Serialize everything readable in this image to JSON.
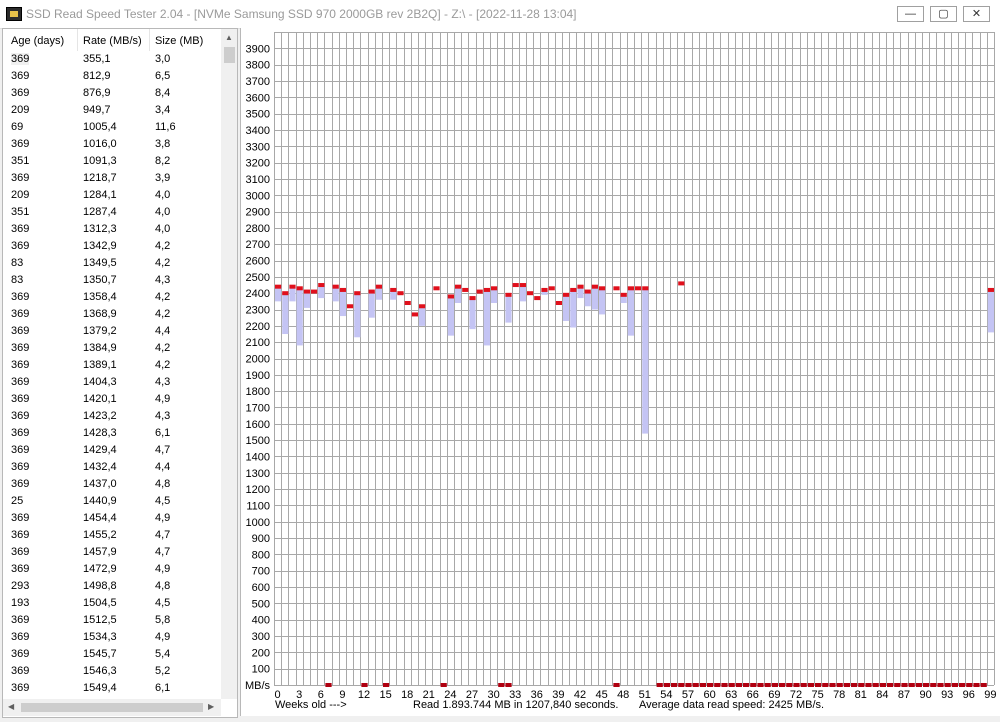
{
  "window": {
    "title": "SSD Read Speed Tester 2.04 - [NVMe Samsung SSD 970 2000GB rev 2B2Q] - Z:\\ - [2022-11-28 13:04]",
    "minimize_glyph": "—",
    "maximize_glyph": "▢",
    "close_glyph": "✕"
  },
  "table": {
    "columns": [
      "Age (days)",
      "Rate (MB/s)",
      "Size (MB)"
    ],
    "rows": [
      [
        "369",
        "355,1",
        "3,0"
      ],
      [
        "369",
        "812,9",
        "6,5"
      ],
      [
        "369",
        "876,9",
        "8,4"
      ],
      [
        "209",
        "949,7",
        "3,4"
      ],
      [
        "69",
        "1005,4",
        "11,6"
      ],
      [
        "369",
        "1016,0",
        "3,8"
      ],
      [
        "351",
        "1091,3",
        "8,2"
      ],
      [
        "369",
        "1218,7",
        "3,9"
      ],
      [
        "209",
        "1284,1",
        "4,0"
      ],
      [
        "351",
        "1287,4",
        "4,0"
      ],
      [
        "369",
        "1312,3",
        "4,0"
      ],
      [
        "369",
        "1342,9",
        "4,2"
      ],
      [
        "83",
        "1349,5",
        "4,2"
      ],
      [
        "83",
        "1350,7",
        "4,3"
      ],
      [
        "369",
        "1358,4",
        "4,2"
      ],
      [
        "369",
        "1368,9",
        "4,2"
      ],
      [
        "369",
        "1379,2",
        "4,4"
      ],
      [
        "369",
        "1384,9",
        "4,2"
      ],
      [
        "369",
        "1389,1",
        "4,2"
      ],
      [
        "369",
        "1404,3",
        "4,3"
      ],
      [
        "369",
        "1420,1",
        "4,9"
      ],
      [
        "369",
        "1423,2",
        "4,3"
      ],
      [
        "369",
        "1428,3",
        "6,1"
      ],
      [
        "369",
        "1429,4",
        "4,7"
      ],
      [
        "369",
        "1432,4",
        "4,4"
      ],
      [
        "369",
        "1437,0",
        "4,8"
      ],
      [
        "25",
        "1440,9",
        "4,5"
      ],
      [
        "369",
        "1454,4",
        "4,9"
      ],
      [
        "369",
        "1455,2",
        "4,7"
      ],
      [
        "369",
        "1457,9",
        "4,7"
      ],
      [
        "369",
        "1472,9",
        "4,9"
      ],
      [
        "293",
        "1498,8",
        "4,8"
      ],
      [
        "193",
        "1504,5",
        "4,5"
      ],
      [
        "369",
        "1512,5",
        "5,8"
      ],
      [
        "369",
        "1534,3",
        "4,9"
      ],
      [
        "369",
        "1545,7",
        "5,4"
      ],
      [
        "369",
        "1546,3",
        "5,2"
      ],
      [
        "369",
        "1549,4",
        "6,1"
      ]
    ]
  },
  "status": {
    "weeks_label": "Weeks old --->",
    "read_summary": "Read 1.893.744 MB in 1207,840 seconds.",
    "average": "Average data read speed: 2425 MB/s."
  },
  "chart_data": {
    "type": "bar",
    "ylabel": "MB/s",
    "xlabel": "Weeks old --->",
    "ylim": [
      0,
      4000
    ],
    "y_ticks": [
      100,
      200,
      300,
      400,
      500,
      600,
      700,
      800,
      900,
      1000,
      1100,
      1200,
      1300,
      1400,
      1500,
      1600,
      1700,
      1800,
      1900,
      2000,
      2100,
      2200,
      2300,
      2400,
      2500,
      2600,
      2700,
      2800,
      2900,
      3000,
      3100,
      3200,
      3300,
      3400,
      3500,
      3600,
      3700,
      3800,
      3900
    ],
    "x_range": [
      0,
      99
    ],
    "x_ticks": [
      0,
      3,
      6,
      9,
      12,
      15,
      18,
      21,
      24,
      27,
      30,
      33,
      36,
      39,
      42,
      45,
      48,
      51,
      54,
      57,
      60,
      63,
      66,
      69,
      72,
      75,
      78,
      81,
      84,
      87,
      90,
      93,
      96,
      99
    ],
    "grid": true,
    "colors": {
      "average": "#e0101c",
      "range": "#c4c4f4",
      "grid": "#a8a8a8"
    },
    "weeks": [
      {
        "week": 0,
        "avg": 2440,
        "min": 2350
      },
      {
        "week": 1,
        "avg": 2400,
        "min": 2150
      },
      {
        "week": 2,
        "avg": 2440,
        "min": 2350
      },
      {
        "week": 3,
        "avg": 2430,
        "min": 2080
      },
      {
        "week": 4,
        "avg": 2410,
        "min": 2310
      },
      {
        "week": 5,
        "avg": 2410,
        "min": 2410
      },
      {
        "week": 6,
        "avg": 2450,
        "min": 2370
      },
      {
        "week": 8,
        "avg": 2440,
        "min": 2350
      },
      {
        "week": 9,
        "avg": 2420,
        "min": 2260
      },
      {
        "week": 10,
        "avg": 2320,
        "min": 2320
      },
      {
        "week": 11,
        "avg": 2400,
        "min": 2130
      },
      {
        "week": 13,
        "avg": 2410,
        "min": 2250
      },
      {
        "week": 14,
        "avg": 2440,
        "min": 2360
      },
      {
        "week": 16,
        "avg": 2420,
        "min": 2360
      },
      {
        "week": 17,
        "avg": 2400,
        "min": 2400
      },
      {
        "week": 18,
        "avg": 2340,
        "min": 2340
      },
      {
        "week": 19,
        "avg": 2270,
        "min": 2270
      },
      {
        "week": 20,
        "avg": 2320,
        "min": 2200
      },
      {
        "week": 22,
        "avg": 2430,
        "min": 2430
      },
      {
        "week": 24,
        "avg": 2380,
        "min": 2140
      },
      {
        "week": 25,
        "avg": 2440,
        "min": 2340
      },
      {
        "week": 26,
        "avg": 2420,
        "min": 2420
      },
      {
        "week": 27,
        "avg": 2370,
        "min": 2180
      },
      {
        "week": 28,
        "avg": 2410,
        "min": 2410
      },
      {
        "week": 29,
        "avg": 2420,
        "min": 2080
      },
      {
        "week": 30,
        "avg": 2430,
        "min": 2340
      },
      {
        "week": 32,
        "avg": 2390,
        "min": 2220
      },
      {
        "week": 33,
        "avg": 2450,
        "min": 2450
      },
      {
        "week": 34,
        "avg": 2450,
        "min": 2350
      },
      {
        "week": 35,
        "avg": 2400,
        "min": 2400
      },
      {
        "week": 36,
        "avg": 2370,
        "min": 2370
      },
      {
        "week": 37,
        "avg": 2420,
        "min": 2390
      },
      {
        "week": 38,
        "avg": 2430,
        "min": 2430
      },
      {
        "week": 39,
        "avg": 2340,
        "min": 2340
      },
      {
        "week": 40,
        "avg": 2390,
        "min": 2230
      },
      {
        "week": 41,
        "avg": 2420,
        "min": 2190
      },
      {
        "week": 42,
        "avg": 2440,
        "min": 2370
      },
      {
        "week": 43,
        "avg": 2410,
        "min": 2320
      },
      {
        "week": 44,
        "avg": 2440,
        "min": 2300
      },
      {
        "week": 45,
        "avg": 2430,
        "min": 2270
      },
      {
        "week": 47,
        "avg": 2430,
        "min": 2430
      },
      {
        "week": 48,
        "avg": 2390,
        "min": 2340
      },
      {
        "week": 49,
        "avg": 2430,
        "min": 2140
      },
      {
        "week": 50,
        "avg": 2430,
        "min": 2430
      },
      {
        "week": 51,
        "avg": 2430,
        "min": 1540
      },
      {
        "week": 56,
        "avg": 2460,
        "min": 2460
      },
      {
        "week": 99,
        "avg": 2420,
        "min": 2160
      }
    ],
    "zero_weeks": [
      7,
      12,
      15,
      23,
      31,
      32,
      47,
      53,
      54,
      55,
      56,
      57,
      58,
      59,
      60,
      61,
      62,
      63,
      64,
      65,
      66,
      67,
      68,
      69,
      70,
      71,
      72,
      73,
      74,
      75,
      76,
      77,
      78,
      79,
      80,
      81,
      82,
      83,
      84,
      85,
      86,
      87,
      88,
      89,
      90,
      91,
      92,
      93,
      94,
      95,
      96,
      97,
      98
    ]
  }
}
